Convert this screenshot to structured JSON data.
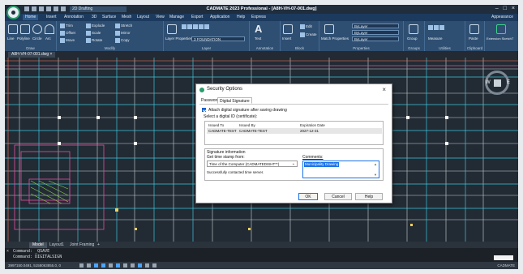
{
  "app": {
    "workspace": "2D Drafting",
    "title": "CADMATE 2023 Professional - [A8H-VH-07-001.dwg]",
    "appearance": "Appearance",
    "window_controls": [
      "–",
      "□",
      "×"
    ]
  },
  "menu": {
    "tabs": [
      "Home",
      "Insert",
      "Annotation",
      "3D",
      "Surface",
      "Mesh",
      "Layout",
      "View",
      "Manage",
      "Export",
      "Application",
      "Help",
      "Express"
    ],
    "active": "Home"
  },
  "ribbon": {
    "draw": {
      "label": "Draw",
      "items": [
        "Line",
        "Polyline",
        "Circle",
        "Arc"
      ]
    },
    "modify": {
      "label": "Modify",
      "items": [
        "Trim",
        "Explode",
        "Stretch",
        "Offset",
        "Scale",
        "Mirror",
        "Move",
        "Rotate",
        "Copy"
      ]
    },
    "layer": {
      "label": "Layer",
      "layer_props": "Layer Properties",
      "current": "3 FOUNDATION"
    },
    "annotation": {
      "label": "Annotation",
      "text": "Text"
    },
    "block": {
      "label": "Block",
      "insert": "Insert",
      "edit": "Edit",
      "create": "Create"
    },
    "properties": {
      "label": "Properties",
      "match": "Match Properties",
      "bylayer1": "ByLayer",
      "bylayer2": "ByLayer",
      "bylayer3": "ByLayer"
    },
    "groups": {
      "label": "Groups",
      "group": "Group"
    },
    "utilities": {
      "label": "Utilities",
      "measure": "Measure"
    },
    "clipboard": {
      "label": "Clipboard",
      "paste": "Paste"
    },
    "extension": {
      "label": "Extension SketchT",
      "ext": "Extension SketchT"
    }
  },
  "document_tab": "A8H-VH-07-001.dwg",
  "viewcube": {
    "west": "W",
    "east": "E"
  },
  "layout_tabs": [
    "Model",
    "Layout1",
    "Joint Framing",
    "+"
  ],
  "command_lines": [
    "Command: _QSAVE",
    "Command: DIGITALSIGN"
  ],
  "status": {
    "coordinates": "3997150.0491, 5158063855.0, 0",
    "brand": "CADMATE"
  },
  "dialog": {
    "title": "Security Options",
    "tabs": [
      "Password",
      "Digital Signature"
    ],
    "active_tab": "Digital Signature",
    "attach_label": "Attach digital signature after saving drawing",
    "attach_checked": true,
    "select_id_label": "Select a digital ID (certificate):",
    "columns": [
      "Issued To",
      "Issued By",
      "Expiration Date"
    ],
    "certificates": [
      {
        "issued_to": "CADMATE-TEST",
        "issued_by": "CADMATE-TEST",
        "expiration": "2027-12-31"
      }
    ],
    "signature_info_label": "Signature information",
    "timestamp_label": "Get time stamp from:",
    "timestamp_value": "Time of the Computer (CADMATEDISHT**)",
    "timestamp_status": "Successfully contacted time server.",
    "comments_label": "Comments:",
    "comments_value": "Municipality Drawing",
    "buttons": {
      "ok": "OK",
      "cancel": "Cancel",
      "help": "Help"
    },
    "close": "×"
  }
}
